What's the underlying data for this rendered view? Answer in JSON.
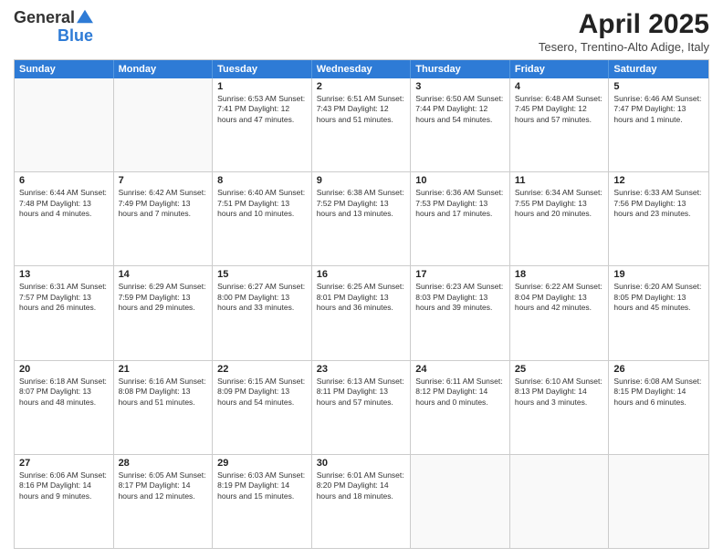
{
  "header": {
    "logo": {
      "general": "General",
      "blue": "Blue",
      "alt": "GeneralBlue logo"
    },
    "title": "April 2025",
    "location": "Tesero, Trentino-Alto Adige, Italy"
  },
  "calendar": {
    "weekdays": [
      "Sunday",
      "Monday",
      "Tuesday",
      "Wednesday",
      "Thursday",
      "Friday",
      "Saturday"
    ],
    "rows": [
      [
        {
          "day": "",
          "info": ""
        },
        {
          "day": "",
          "info": ""
        },
        {
          "day": "1",
          "info": "Sunrise: 6:53 AM\nSunset: 7:41 PM\nDaylight: 12 hours\nand 47 minutes."
        },
        {
          "day": "2",
          "info": "Sunrise: 6:51 AM\nSunset: 7:43 PM\nDaylight: 12 hours\nand 51 minutes."
        },
        {
          "day": "3",
          "info": "Sunrise: 6:50 AM\nSunset: 7:44 PM\nDaylight: 12 hours\nand 54 minutes."
        },
        {
          "day": "4",
          "info": "Sunrise: 6:48 AM\nSunset: 7:45 PM\nDaylight: 12 hours\nand 57 minutes."
        },
        {
          "day": "5",
          "info": "Sunrise: 6:46 AM\nSunset: 7:47 PM\nDaylight: 13 hours\nand 1 minute."
        }
      ],
      [
        {
          "day": "6",
          "info": "Sunrise: 6:44 AM\nSunset: 7:48 PM\nDaylight: 13 hours\nand 4 minutes."
        },
        {
          "day": "7",
          "info": "Sunrise: 6:42 AM\nSunset: 7:49 PM\nDaylight: 13 hours\nand 7 minutes."
        },
        {
          "day": "8",
          "info": "Sunrise: 6:40 AM\nSunset: 7:51 PM\nDaylight: 13 hours\nand 10 minutes."
        },
        {
          "day": "9",
          "info": "Sunrise: 6:38 AM\nSunset: 7:52 PM\nDaylight: 13 hours\nand 13 minutes."
        },
        {
          "day": "10",
          "info": "Sunrise: 6:36 AM\nSunset: 7:53 PM\nDaylight: 13 hours\nand 17 minutes."
        },
        {
          "day": "11",
          "info": "Sunrise: 6:34 AM\nSunset: 7:55 PM\nDaylight: 13 hours\nand 20 minutes."
        },
        {
          "day": "12",
          "info": "Sunrise: 6:33 AM\nSunset: 7:56 PM\nDaylight: 13 hours\nand 23 minutes."
        }
      ],
      [
        {
          "day": "13",
          "info": "Sunrise: 6:31 AM\nSunset: 7:57 PM\nDaylight: 13 hours\nand 26 minutes."
        },
        {
          "day": "14",
          "info": "Sunrise: 6:29 AM\nSunset: 7:59 PM\nDaylight: 13 hours\nand 29 minutes."
        },
        {
          "day": "15",
          "info": "Sunrise: 6:27 AM\nSunset: 8:00 PM\nDaylight: 13 hours\nand 33 minutes."
        },
        {
          "day": "16",
          "info": "Sunrise: 6:25 AM\nSunset: 8:01 PM\nDaylight: 13 hours\nand 36 minutes."
        },
        {
          "day": "17",
          "info": "Sunrise: 6:23 AM\nSunset: 8:03 PM\nDaylight: 13 hours\nand 39 minutes."
        },
        {
          "day": "18",
          "info": "Sunrise: 6:22 AM\nSunset: 8:04 PM\nDaylight: 13 hours\nand 42 minutes."
        },
        {
          "day": "19",
          "info": "Sunrise: 6:20 AM\nSunset: 8:05 PM\nDaylight: 13 hours\nand 45 minutes."
        }
      ],
      [
        {
          "day": "20",
          "info": "Sunrise: 6:18 AM\nSunset: 8:07 PM\nDaylight: 13 hours\nand 48 minutes."
        },
        {
          "day": "21",
          "info": "Sunrise: 6:16 AM\nSunset: 8:08 PM\nDaylight: 13 hours\nand 51 minutes."
        },
        {
          "day": "22",
          "info": "Sunrise: 6:15 AM\nSunset: 8:09 PM\nDaylight: 13 hours\nand 54 minutes."
        },
        {
          "day": "23",
          "info": "Sunrise: 6:13 AM\nSunset: 8:11 PM\nDaylight: 13 hours\nand 57 minutes."
        },
        {
          "day": "24",
          "info": "Sunrise: 6:11 AM\nSunset: 8:12 PM\nDaylight: 14 hours\nand 0 minutes."
        },
        {
          "day": "25",
          "info": "Sunrise: 6:10 AM\nSunset: 8:13 PM\nDaylight: 14 hours\nand 3 minutes."
        },
        {
          "day": "26",
          "info": "Sunrise: 6:08 AM\nSunset: 8:15 PM\nDaylight: 14 hours\nand 6 minutes."
        }
      ],
      [
        {
          "day": "27",
          "info": "Sunrise: 6:06 AM\nSunset: 8:16 PM\nDaylight: 14 hours\nand 9 minutes."
        },
        {
          "day": "28",
          "info": "Sunrise: 6:05 AM\nSunset: 8:17 PM\nDaylight: 14 hours\nand 12 minutes."
        },
        {
          "day": "29",
          "info": "Sunrise: 6:03 AM\nSunset: 8:19 PM\nDaylight: 14 hours\nand 15 minutes."
        },
        {
          "day": "30",
          "info": "Sunrise: 6:01 AM\nSunset: 8:20 PM\nDaylight: 14 hours\nand 18 minutes."
        },
        {
          "day": "",
          "info": ""
        },
        {
          "day": "",
          "info": ""
        },
        {
          "day": "",
          "info": ""
        }
      ]
    ]
  }
}
